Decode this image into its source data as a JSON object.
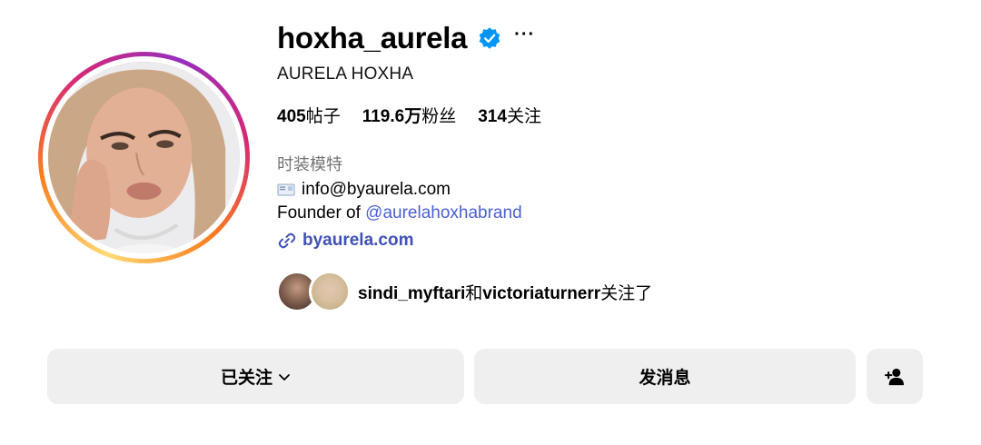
{
  "profile": {
    "username": "hoxha_aurela",
    "more_label": "···",
    "full_name": "AURELA HOXHA",
    "stats": {
      "posts_value": "405",
      "posts_label": "帖子",
      "followers_value": "119.6万",
      "followers_label": "粉丝",
      "following_value": "314",
      "following_label": "关注"
    },
    "category": "时装模特",
    "bio": {
      "email": "info@byaurela.com",
      "founder_prefix": "Founder of ",
      "founder_mention": "@aurelahoxhabrand",
      "link": "byaurela.com"
    },
    "followed_by": {
      "user1": "sindi_myftari",
      "joiner": "和",
      "user2": "victoriaturnerr",
      "suffix": "关注了"
    }
  },
  "actions": {
    "following_label": "已关注",
    "message_label": "发消息"
  },
  "icons": {
    "verified": "verified-badge-icon",
    "link": "link-icon",
    "email": "envelope-icon",
    "chevron": "chevron-down-icon",
    "add_user": "add-user-icon"
  },
  "colors": {
    "verified_blue": "#0095f6",
    "mention_blue": "#4a5fd6",
    "button_gray": "#efefef",
    "muted_text": "#737373"
  }
}
